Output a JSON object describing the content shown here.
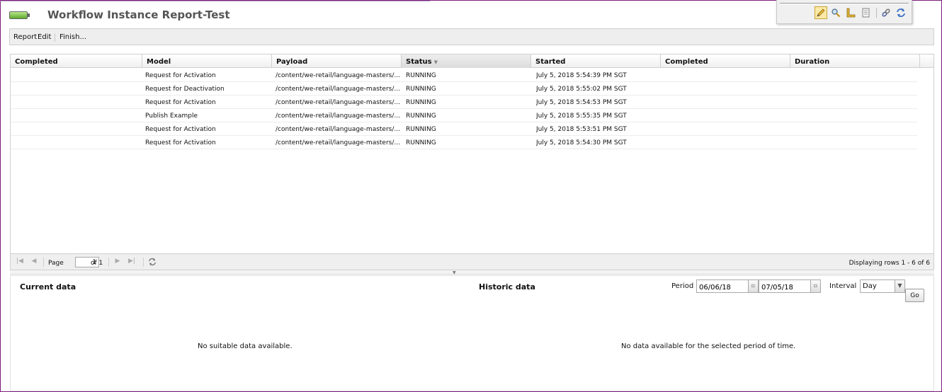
{
  "app": {
    "title": "Workflow Instance Report-Test"
  },
  "toolbar_icons": [
    "pencil-icon",
    "magnifier-icon",
    "ruler-icon",
    "document-icon",
    "link-icon",
    "refresh-icon"
  ],
  "menu": {
    "report": "Report",
    "edit": "Edit",
    "finish": "Finish..."
  },
  "table": {
    "columns": [
      "Completed",
      "Model",
      "Payload",
      "Status",
      "Started",
      "Completed",
      "Duration"
    ],
    "sorted_column": "Status",
    "rows": [
      {
        "completed": "",
        "model": "Request for Activation",
        "payload": "/content/we-retail/language-masters/...",
        "status": "RUNNING",
        "started": "July 5, 2018 5:54:39 PM SGT",
        "completed2": "",
        "duration": ""
      },
      {
        "completed": "",
        "model": "Request for Deactivation",
        "payload": "/content/we-retail/language-masters/...",
        "status": "RUNNING",
        "started": "July 5, 2018 5:55:02 PM SGT",
        "completed2": "",
        "duration": ""
      },
      {
        "completed": "",
        "model": "Request for Activation",
        "payload": "/content/we-retail/language-masters/...",
        "status": "RUNNING",
        "started": "July 5, 2018 5:54:53 PM SGT",
        "completed2": "",
        "duration": ""
      },
      {
        "completed": "",
        "model": "Publish Example",
        "payload": "/content/we-retail/language-masters/...",
        "status": "RUNNING",
        "started": "July 5, 2018 5:55:35 PM SGT",
        "completed2": "",
        "duration": ""
      },
      {
        "completed": "",
        "model": "Request for Activation",
        "payload": "/content/we-retail/language-masters/...",
        "status": "RUNNING",
        "started": "July 5, 2018 5:53:51 PM SGT",
        "completed2": "",
        "duration": ""
      },
      {
        "completed": "",
        "model": "Request for Activation",
        "payload": "/content/we-retail/language-masters/...",
        "status": "RUNNING",
        "started": "July 5, 2018 5:54:30 PM SGT",
        "completed2": "",
        "duration": ""
      }
    ]
  },
  "pager": {
    "page_label": "Page",
    "page_value": "1",
    "of_label": "of 1",
    "display_text": "Displaying rows 1 - 6 of 6"
  },
  "current": {
    "title": "Current data",
    "empty": "No suitable data available."
  },
  "historic": {
    "title": "Historic data",
    "period_label": "Period",
    "from": "06/06/18",
    "to": "07/05/18",
    "interval_label": "Interval",
    "interval": "Day",
    "go": "Go",
    "empty": "No data available for the selected period of time."
  }
}
